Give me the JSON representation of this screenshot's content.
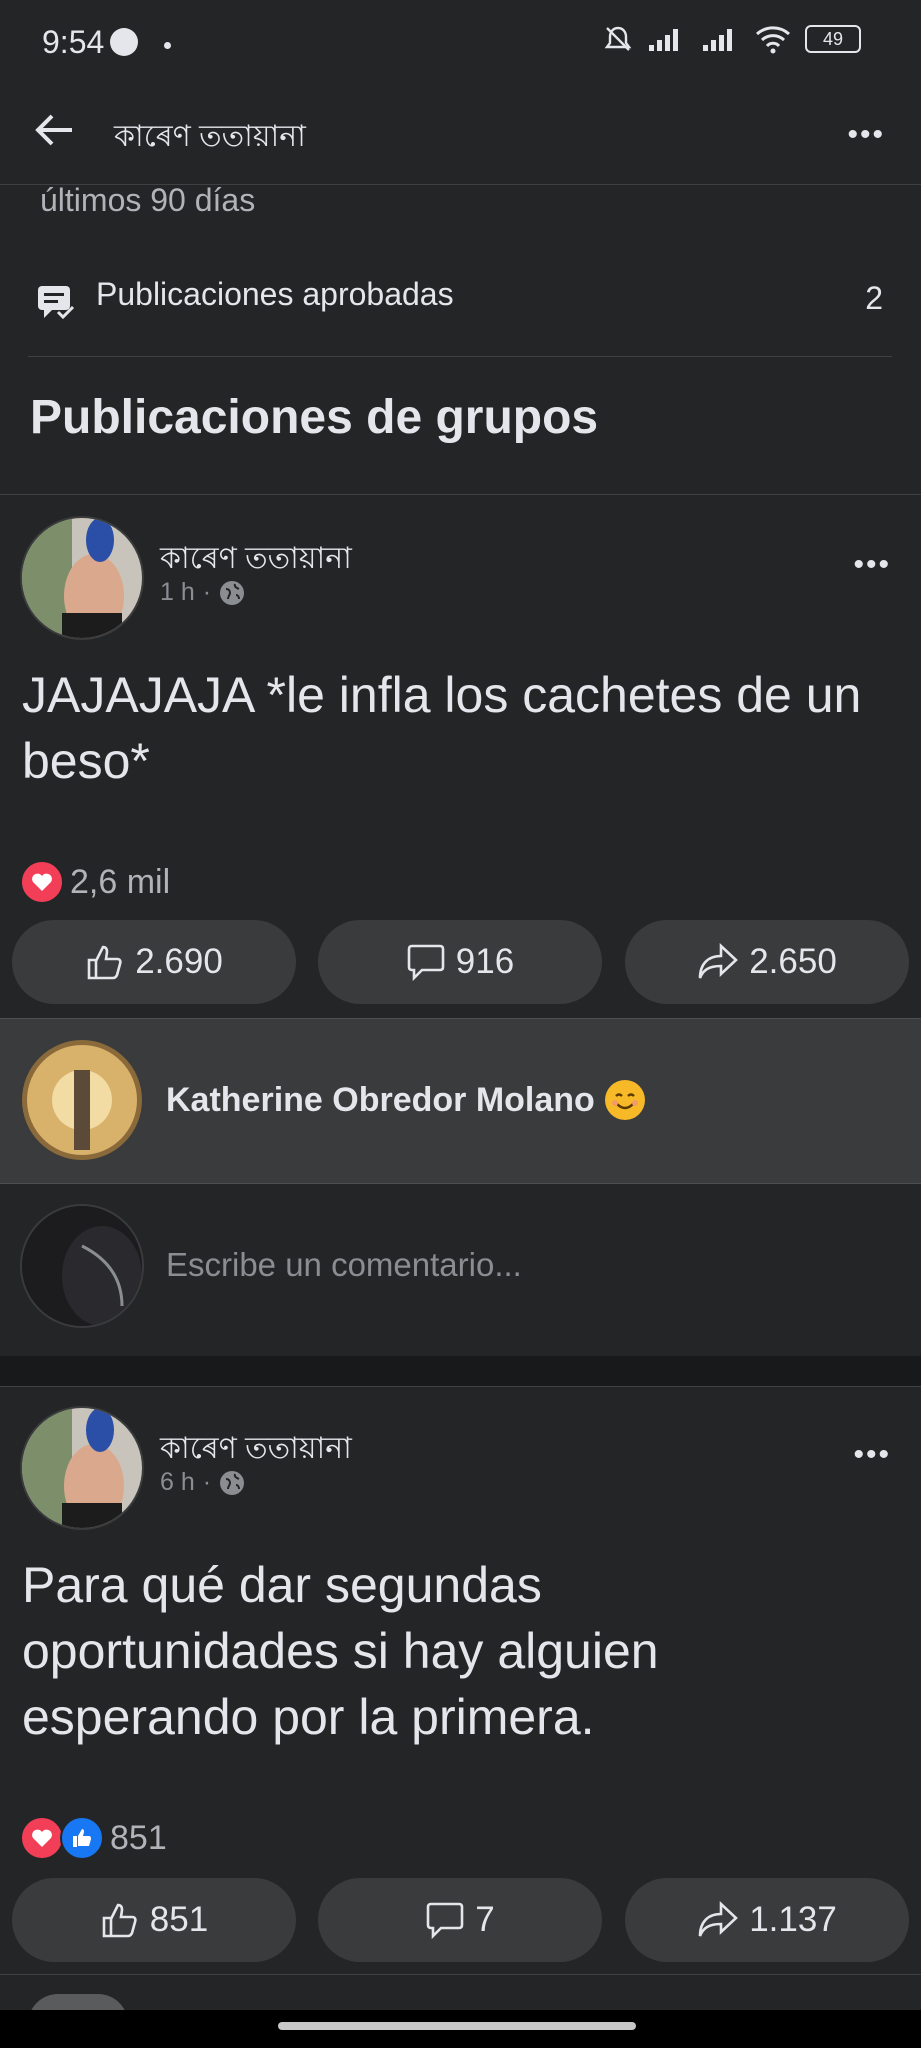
{
  "status": {
    "time": "9:54",
    "battery": "49"
  },
  "header": {
    "title": "কাৰেণ ততায়ানা"
  },
  "stats": {
    "cutoff_text": "últimos 90 días",
    "approved_label": "Publicaciones aprobadas",
    "approved_count": "2"
  },
  "section_title": "Publicaciones de grupos",
  "posts": [
    {
      "author": "কাৰেণ ততায়ানা",
      "time": "1 h",
      "text": "JAJAJAJA *le infla los cachetes de un beso*",
      "reaction_count": "2,6 mil",
      "likes": "2.690",
      "comments": "916",
      "shares": "2.650"
    },
    {
      "author": "কাৰেণ ততায়ানা",
      "time": "6 h",
      "text": "Para qué dar segundas oportunidades si hay alguien esperando por la primera.",
      "reaction_count": "851",
      "likes": "851",
      "comments": "7",
      "shares": "1.137"
    }
  ],
  "top_comment": {
    "name": "Katherine Obredor Molano",
    "emoji": "smiling-face-icon"
  },
  "comment_box": {
    "placeholder": "Escribe un comentario..."
  },
  "colors": {
    "background": "#242526",
    "pill": "#3a3b3c",
    "heart": "#f33e58",
    "like": "#1877f2"
  }
}
